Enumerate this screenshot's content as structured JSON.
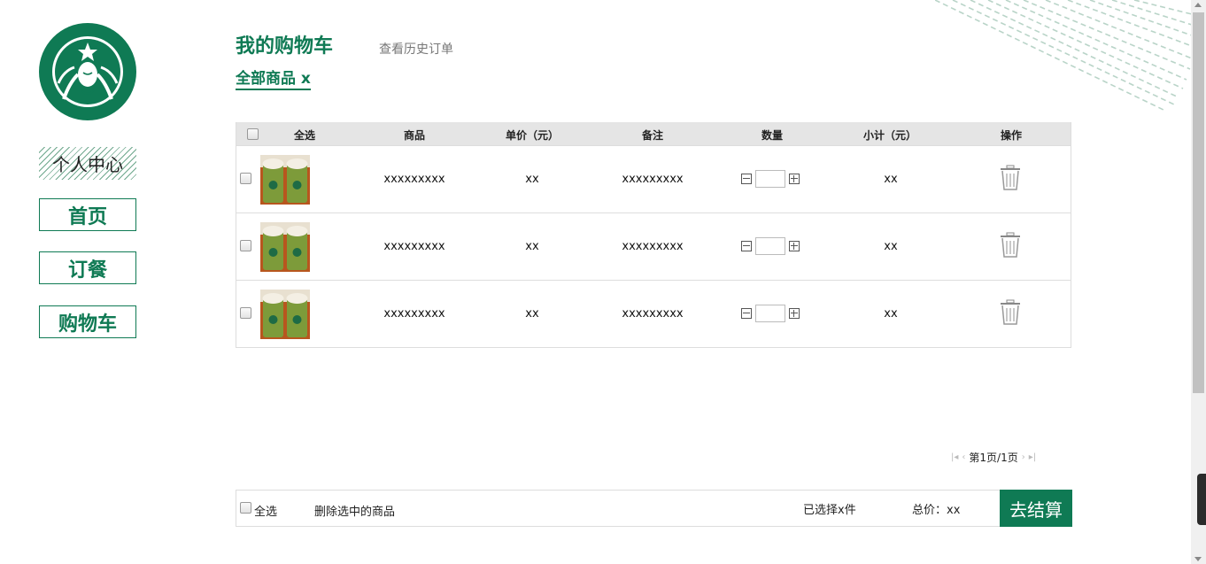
{
  "brand": {
    "name": "Starbucks",
    "logo_icon": "starbucks-siren-logo",
    "accent": "#0f7a54"
  },
  "sidebar": {
    "items": [
      {
        "label": "个人中心"
      },
      {
        "label": "首页"
      },
      {
        "label": "订餐"
      },
      {
        "label": "购物车"
      }
    ]
  },
  "header": {
    "title": "我的购物车",
    "history_link": "查看历史订单"
  },
  "filter": {
    "label": "全部商品 x"
  },
  "table": {
    "headers": {
      "select_all": "全选",
      "product": "商品",
      "unit_price": "单价（元）",
      "note": "备注",
      "quantity": "数量",
      "subtotal": "小计（元）",
      "action": "操作"
    },
    "rows": [
      {
        "product": "xxxxxxxxx",
        "price": "xx",
        "note": "xxxxxxxxx",
        "qty": "",
        "subtotal": "xx"
      },
      {
        "product": "xxxxxxxxx",
        "price": "xx",
        "note": "xxxxxxxxx",
        "qty": "",
        "subtotal": "xx"
      },
      {
        "product": "xxxxxxxxx",
        "price": "xx",
        "note": "xxxxxxxxx",
        "qty": "",
        "subtotal": "xx"
      }
    ]
  },
  "pagination": {
    "label": "第1页/1页"
  },
  "footer": {
    "select_all": "全选",
    "delete_selected": "删除选中的商品",
    "selected_count": "已选择x件",
    "total": "总价：xx",
    "checkout": "去结算"
  }
}
